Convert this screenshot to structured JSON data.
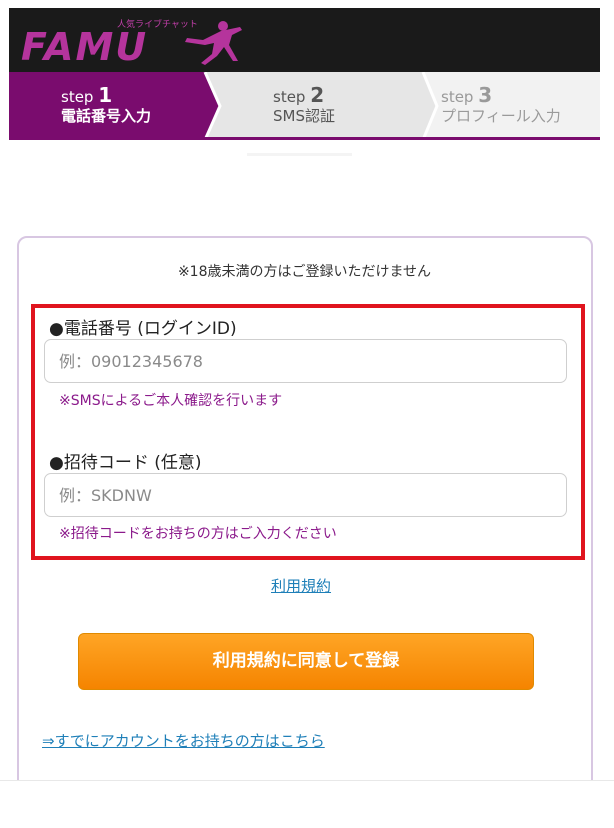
{
  "header": {
    "logo_text": "FAMU",
    "logo_tagline": "人気ライブチャット"
  },
  "steps": [
    {
      "prefix": "step",
      "number": "1",
      "label": "電話番号入力",
      "state": "active"
    },
    {
      "prefix": "step",
      "number": "2",
      "label": "SMS認証",
      "state": "upcoming"
    },
    {
      "prefix": "step",
      "number": "3",
      "label": "プロフィール入力",
      "state": "upcoming"
    }
  ],
  "form": {
    "notice": "※18歳未満の方はご登録いただけません",
    "phone": {
      "label": "●電話番号 (ログインID)",
      "placeholder": "例：09012345678",
      "value": "",
      "hint": "※SMSによるご本人確認を行います"
    },
    "invite": {
      "label": "●招待コード (任意)",
      "placeholder": "例：SKDNW",
      "value": "",
      "hint": "※招待コードをお持ちの方はご入力ください"
    },
    "terms_link": "利用規約",
    "submit_label": "利用規約に同意して登録",
    "login_link": "⇒すでにアカウントをお持ちの方はこちら"
  },
  "colors": {
    "brand_purple": "#7a0c6e",
    "header_bg": "#1a1a1a",
    "button_orange": "#f7941d",
    "link_blue": "#1e7fb8",
    "hint_purple": "#8b1a8b",
    "highlight_red": "#e0141e"
  }
}
